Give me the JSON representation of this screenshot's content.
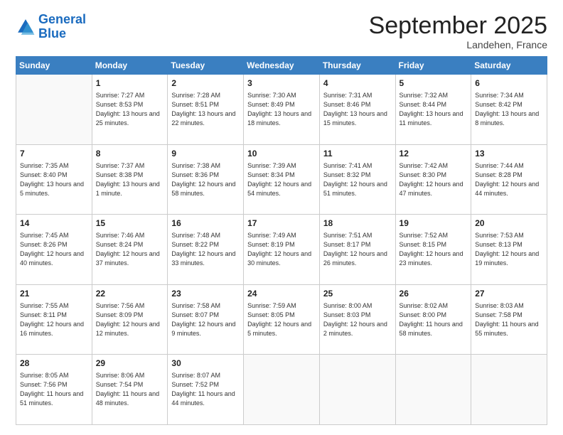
{
  "logo": {
    "line1": "General",
    "line2": "Blue"
  },
  "title": "September 2025",
  "subtitle": "Landehen, France",
  "days_of_week": [
    "Sunday",
    "Monday",
    "Tuesday",
    "Wednesday",
    "Thursday",
    "Friday",
    "Saturday"
  ],
  "weeks": [
    [
      {
        "day": "",
        "info": ""
      },
      {
        "day": "1",
        "info": "Sunrise: 7:27 AM\nSunset: 8:53 PM\nDaylight: 13 hours\nand 25 minutes."
      },
      {
        "day": "2",
        "info": "Sunrise: 7:28 AM\nSunset: 8:51 PM\nDaylight: 13 hours\nand 22 minutes."
      },
      {
        "day": "3",
        "info": "Sunrise: 7:30 AM\nSunset: 8:49 PM\nDaylight: 13 hours\nand 18 minutes."
      },
      {
        "day": "4",
        "info": "Sunrise: 7:31 AM\nSunset: 8:46 PM\nDaylight: 13 hours\nand 15 minutes."
      },
      {
        "day": "5",
        "info": "Sunrise: 7:32 AM\nSunset: 8:44 PM\nDaylight: 13 hours\nand 11 minutes."
      },
      {
        "day": "6",
        "info": "Sunrise: 7:34 AM\nSunset: 8:42 PM\nDaylight: 13 hours\nand 8 minutes."
      }
    ],
    [
      {
        "day": "7",
        "info": "Sunrise: 7:35 AM\nSunset: 8:40 PM\nDaylight: 13 hours\nand 5 minutes."
      },
      {
        "day": "8",
        "info": "Sunrise: 7:37 AM\nSunset: 8:38 PM\nDaylight: 13 hours\nand 1 minute."
      },
      {
        "day": "9",
        "info": "Sunrise: 7:38 AM\nSunset: 8:36 PM\nDaylight: 12 hours\nand 58 minutes."
      },
      {
        "day": "10",
        "info": "Sunrise: 7:39 AM\nSunset: 8:34 PM\nDaylight: 12 hours\nand 54 minutes."
      },
      {
        "day": "11",
        "info": "Sunrise: 7:41 AM\nSunset: 8:32 PM\nDaylight: 12 hours\nand 51 minutes."
      },
      {
        "day": "12",
        "info": "Sunrise: 7:42 AM\nSunset: 8:30 PM\nDaylight: 12 hours\nand 47 minutes."
      },
      {
        "day": "13",
        "info": "Sunrise: 7:44 AM\nSunset: 8:28 PM\nDaylight: 12 hours\nand 44 minutes."
      }
    ],
    [
      {
        "day": "14",
        "info": "Sunrise: 7:45 AM\nSunset: 8:26 PM\nDaylight: 12 hours\nand 40 minutes."
      },
      {
        "day": "15",
        "info": "Sunrise: 7:46 AM\nSunset: 8:24 PM\nDaylight: 12 hours\nand 37 minutes."
      },
      {
        "day": "16",
        "info": "Sunrise: 7:48 AM\nSunset: 8:22 PM\nDaylight: 12 hours\nand 33 minutes."
      },
      {
        "day": "17",
        "info": "Sunrise: 7:49 AM\nSunset: 8:19 PM\nDaylight: 12 hours\nand 30 minutes."
      },
      {
        "day": "18",
        "info": "Sunrise: 7:51 AM\nSunset: 8:17 PM\nDaylight: 12 hours\nand 26 minutes."
      },
      {
        "day": "19",
        "info": "Sunrise: 7:52 AM\nSunset: 8:15 PM\nDaylight: 12 hours\nand 23 minutes."
      },
      {
        "day": "20",
        "info": "Sunrise: 7:53 AM\nSunset: 8:13 PM\nDaylight: 12 hours\nand 19 minutes."
      }
    ],
    [
      {
        "day": "21",
        "info": "Sunrise: 7:55 AM\nSunset: 8:11 PM\nDaylight: 12 hours\nand 16 minutes."
      },
      {
        "day": "22",
        "info": "Sunrise: 7:56 AM\nSunset: 8:09 PM\nDaylight: 12 hours\nand 12 minutes."
      },
      {
        "day": "23",
        "info": "Sunrise: 7:58 AM\nSunset: 8:07 PM\nDaylight: 12 hours\nand 9 minutes."
      },
      {
        "day": "24",
        "info": "Sunrise: 7:59 AM\nSunset: 8:05 PM\nDaylight: 12 hours\nand 5 minutes."
      },
      {
        "day": "25",
        "info": "Sunrise: 8:00 AM\nSunset: 8:03 PM\nDaylight: 12 hours\nand 2 minutes."
      },
      {
        "day": "26",
        "info": "Sunrise: 8:02 AM\nSunset: 8:00 PM\nDaylight: 11 hours\nand 58 minutes."
      },
      {
        "day": "27",
        "info": "Sunrise: 8:03 AM\nSunset: 7:58 PM\nDaylight: 11 hours\nand 55 minutes."
      }
    ],
    [
      {
        "day": "28",
        "info": "Sunrise: 8:05 AM\nSunset: 7:56 PM\nDaylight: 11 hours\nand 51 minutes."
      },
      {
        "day": "29",
        "info": "Sunrise: 8:06 AM\nSunset: 7:54 PM\nDaylight: 11 hours\nand 48 minutes."
      },
      {
        "day": "30",
        "info": "Sunrise: 8:07 AM\nSunset: 7:52 PM\nDaylight: 11 hours\nand 44 minutes."
      },
      {
        "day": "",
        "info": ""
      },
      {
        "day": "",
        "info": ""
      },
      {
        "day": "",
        "info": ""
      },
      {
        "day": "",
        "info": ""
      }
    ]
  ]
}
